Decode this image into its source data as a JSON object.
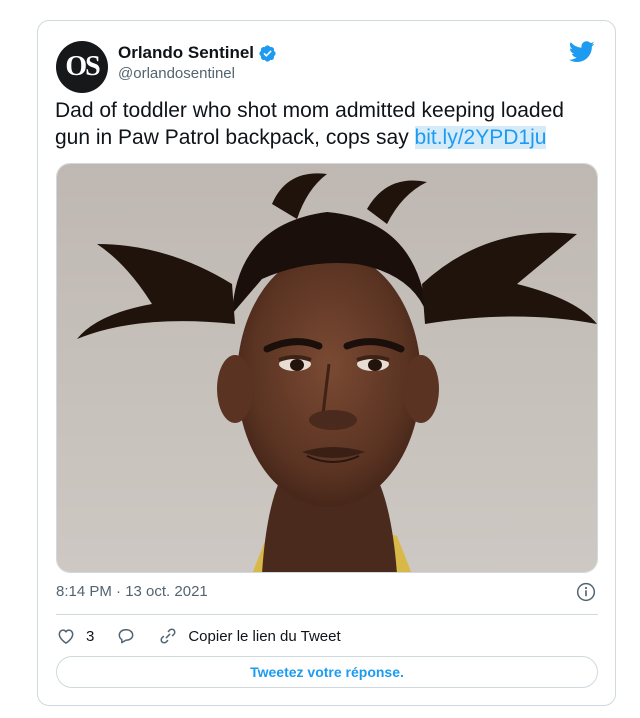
{
  "account": {
    "avatar_text": "OS",
    "display_name": "Orlando Sentinel",
    "handle": "@orlandosentinel",
    "verified": true
  },
  "tweet": {
    "text": "Dad of toddler who shot mom admitted keeping loaded gun in Paw Patrol backpack, cops say ",
    "link": "bit.ly/2YPD1ju",
    "timestamp": "8:14 PM · 13 oct. 2021"
  },
  "actions": {
    "like_count": "3",
    "copy_link_label": "Copier le lien du Tweet"
  },
  "reply_button_label": "Tweetez votre réponse.",
  "icons": [
    "twitter-bird-icon",
    "verified-icon",
    "info-icon",
    "heart-icon",
    "reply-bubble-icon",
    "link-icon"
  ],
  "colors": {
    "accent": "#1d9bf0",
    "border": "#cfd9de",
    "secondary_text": "#536471",
    "link_highlight": "#d6ebfa"
  }
}
